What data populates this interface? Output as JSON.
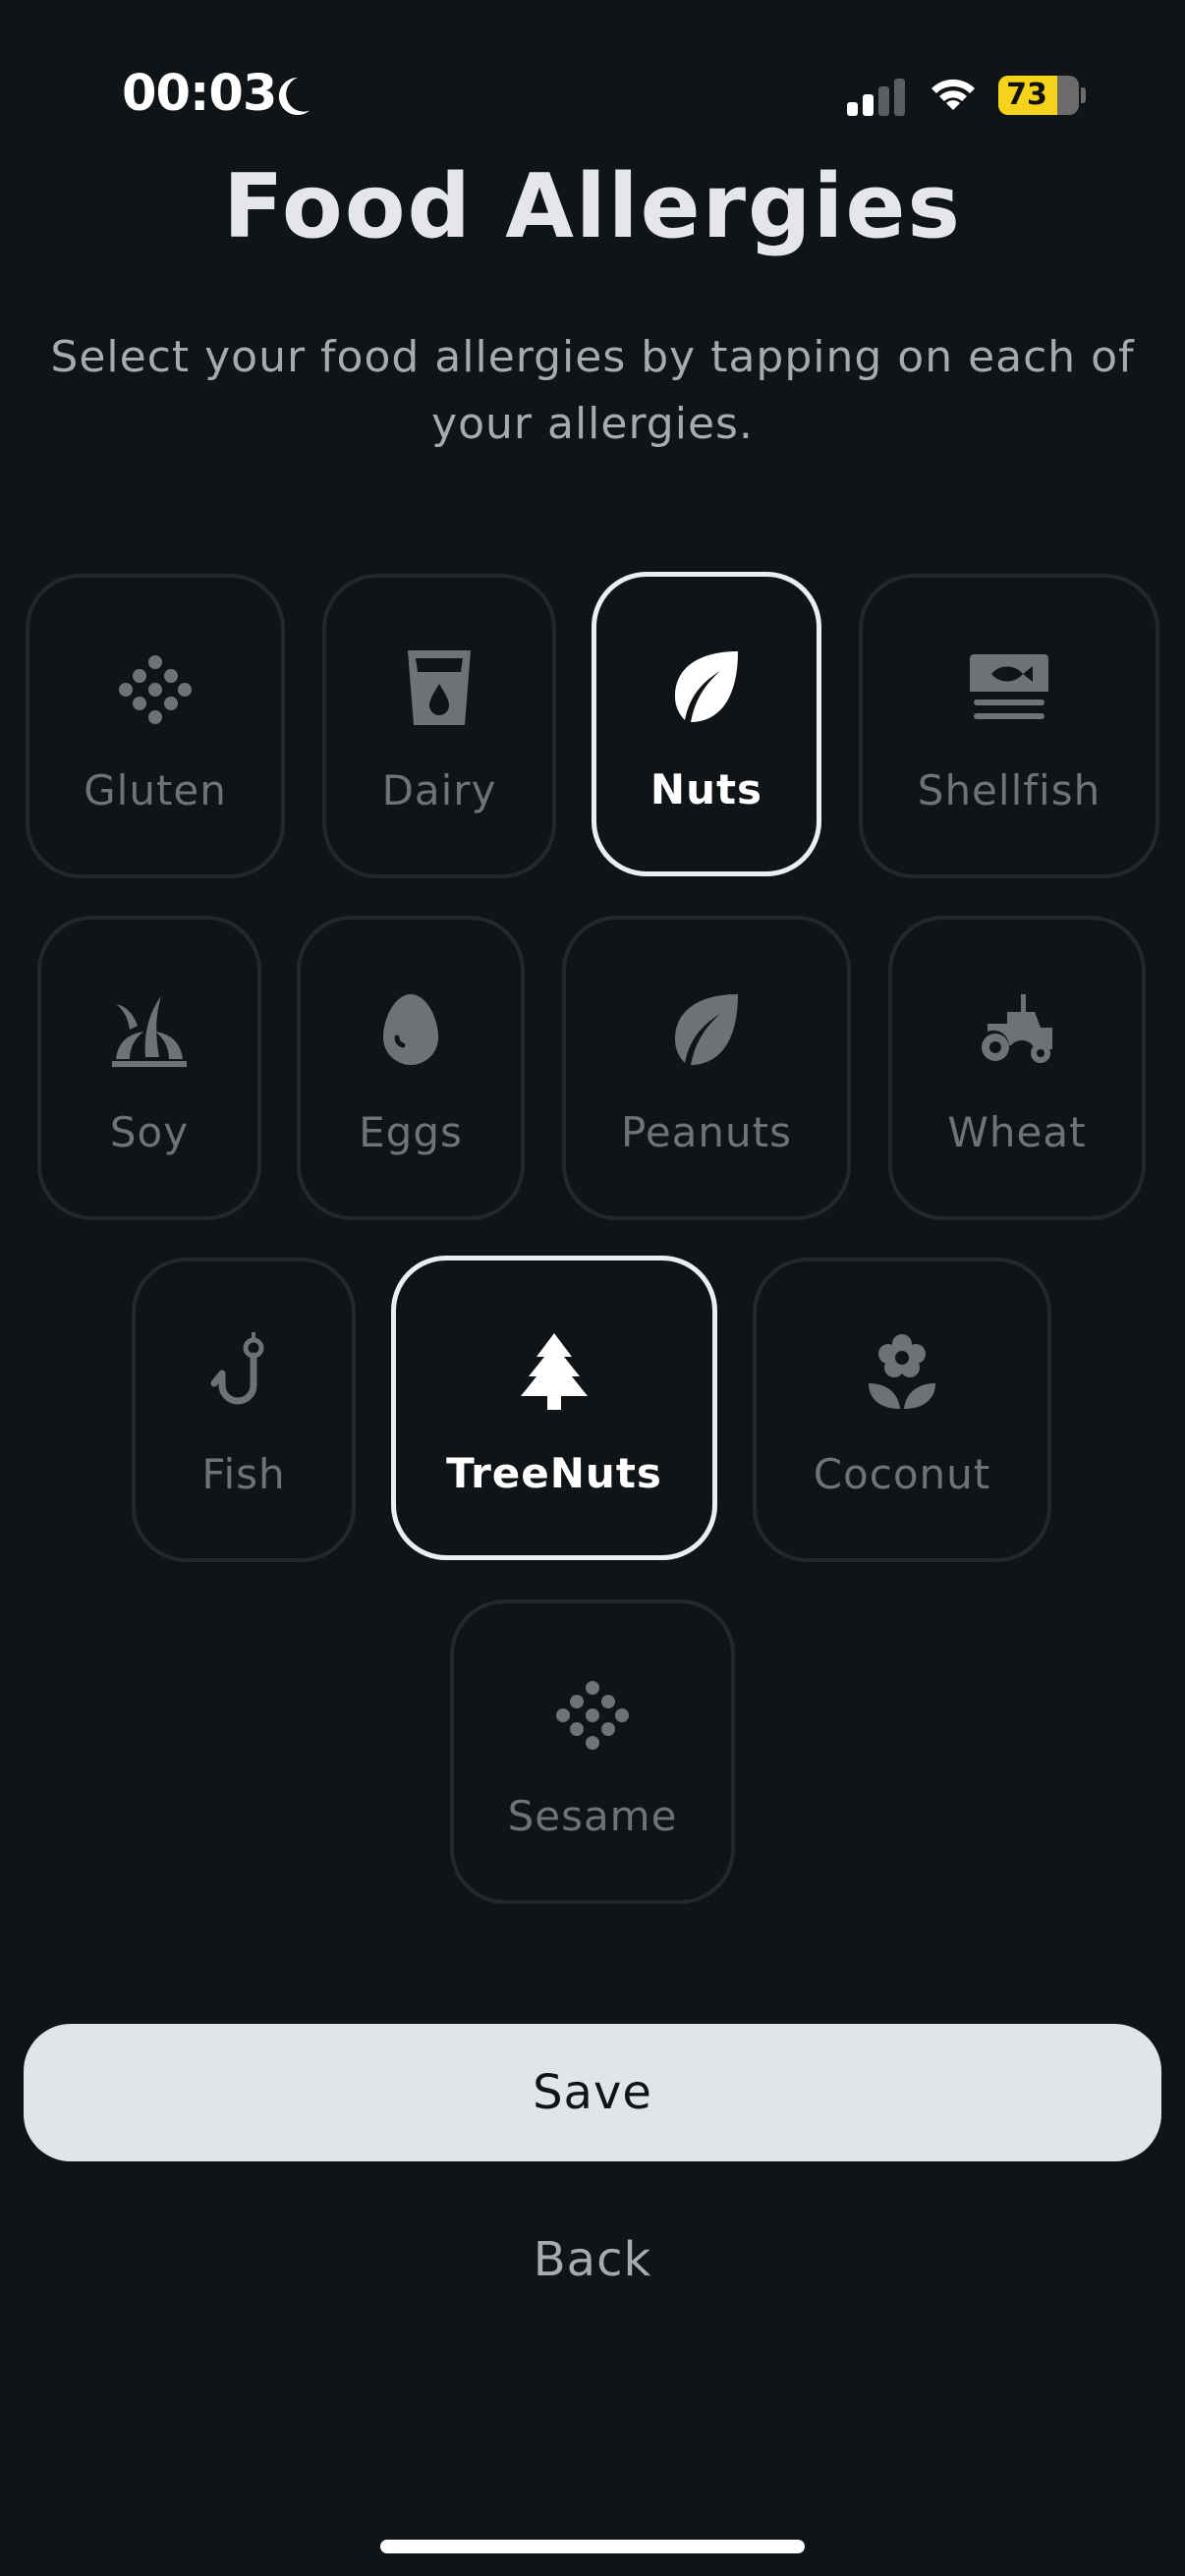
{
  "status_bar": {
    "time": "00:03",
    "battery_percent": "73",
    "battery_level": 0.73,
    "icons": [
      "moon-icon",
      "signal-icon",
      "wifi-icon",
      "battery-icon"
    ]
  },
  "header": {
    "title": "Food Allergies",
    "subtitle": "Select your food allergies by tapping on each of your allergies."
  },
  "allergies": [
    {
      "label": "Gluten",
      "icon": "grain-dots-icon",
      "selected": false
    },
    {
      "label": "Dairy",
      "icon": "milk-glass-icon",
      "selected": false
    },
    {
      "label": "Nuts",
      "icon": "leaf-icon",
      "selected": true
    },
    {
      "label": "Shellfish",
      "icon": "fish-tin-icon",
      "selected": false
    },
    {
      "label": "Soy",
      "icon": "sprout-icon",
      "selected": false
    },
    {
      "label": "Eggs",
      "icon": "egg-icon",
      "selected": false
    },
    {
      "label": "Peanuts",
      "icon": "leaf-icon",
      "selected": false
    },
    {
      "label": "Wheat",
      "icon": "tractor-icon",
      "selected": false
    },
    {
      "label": "Fish",
      "icon": "fish-hook-icon",
      "selected": false
    },
    {
      "label": "TreeNuts",
      "icon": "tree-icon",
      "selected": true
    },
    {
      "label": "Coconut",
      "icon": "flower-icon",
      "selected": false
    },
    {
      "label": "Sesame",
      "icon": "seed-dots-icon",
      "selected": false
    }
  ],
  "actions": {
    "save_label": "Save",
    "back_label": "Back"
  },
  "colors": {
    "background": "#111417",
    "tile_border": "#24282c",
    "tile_selected_border": "#eceff1",
    "save_button_bg": "#e2e5e8",
    "battery_fill": "#f4d31a"
  }
}
